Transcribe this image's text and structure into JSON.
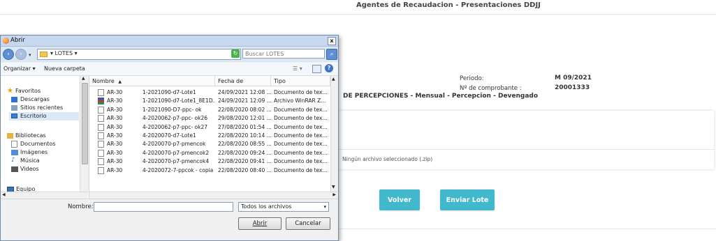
{
  "page": {
    "title": "Agentes de Recaudacion - Presentaciones DDJJ",
    "periodo_label": "Periodo:",
    "periodo_value": "M 09/2021",
    "comprobante_label": "Nº de comprobante :",
    "comprobante_value": "20001333",
    "subtitle": "DE PERCEPCIONES - Mensual - Percepcion - Devengado",
    "file_status": "Ningún archivo seleccionado (.zip)",
    "volver_label": "Volver",
    "enviar_label": "Enviar Lote",
    "accent_color": "#41b8cc"
  },
  "dialog": {
    "title": "Abrir",
    "close": "x",
    "address": "▾ LOTES ▾",
    "search_placeholder": "Buscar LOTES",
    "toolbar": {
      "organize": "Organizar ▾",
      "new_folder": "Nueva carpeta"
    },
    "nav": {
      "favorites": "Favoritos",
      "descargas": "Descargas",
      "recientes": "Sitios recientes",
      "escritorio": "Escritorio",
      "bibliotecas": "Bibliotecas",
      "documentos": "Documentos",
      "imagenes": "Imágenes",
      "musica": "Música",
      "videos": "Videos",
      "equipo": "Equipo"
    },
    "columns": {
      "name": "Nombre",
      "date": "Fecha de modifica...",
      "type": "Tipo"
    },
    "files": [
      {
        "prefix": "AR-30",
        "name": "1-2021090-d7-Lote1",
        "date": "24/09/2021 12:08 ...",
        "type": "Documento de tex...",
        "icon": "text-file-icon"
      },
      {
        "prefix": "AR-30",
        "name": "1-2021090-d7-Lote1_8E1D...",
        "date": "24/09/2021 12:09 ...",
        "type": "Archivo WinRAR Z...",
        "icon": "winrar-icon"
      },
      {
        "prefix": "AR-30",
        "name": "1-2021090-D7-ppc- ok",
        "date": "22/08/2020 08:02 ...",
        "type": "Documento de tex...",
        "icon": "text-file-icon"
      },
      {
        "prefix": "AR-30",
        "name": "4-2020062-p7-ppc- ok26",
        "date": "29/08/2020 12:01 ...",
        "type": "Documento de tex...",
        "icon": "text-file-icon"
      },
      {
        "prefix": "AR-30",
        "name": "4-2020062-p7-ppc- ok27",
        "date": "27/08/2020 01:54 ...",
        "type": "Documento de tex...",
        "icon": "text-file-icon"
      },
      {
        "prefix": "AR-30",
        "name": "4-2020070-d7-Lote1",
        "date": "22/08/2020 10:14 ...",
        "type": "Documento de tex...",
        "icon": "text-file-icon"
      },
      {
        "prefix": "AR-30",
        "name": "4-2020070-p7-pmencok",
        "date": "22/08/2020 08:55 ...",
        "type": "Documento de tex...",
        "icon": "text-file-icon"
      },
      {
        "prefix": "AR-30",
        "name": "4-2020070-p7-pmencok2",
        "date": "22/08/2020 09:24 ...",
        "type": "Documento de tex...",
        "icon": "text-file-icon"
      },
      {
        "prefix": "AR-30",
        "name": "4-2020070-p7-pmencok4",
        "date": "22/08/2020 09:41 ...",
        "type": "Documento de tex...",
        "icon": "text-file-icon"
      },
      {
        "prefix": "AR-30",
        "name": "4-2020072-7-ppcok - copia",
        "date": "22/08/2020 08:40 ...",
        "type": "Documento de tex...",
        "icon": "text-file-icon"
      }
    ],
    "filename_label": "Nombre:",
    "filename_value": "",
    "filter_value": "Todos los archivos",
    "open_label": "Abrir",
    "cancel_label": "Cancelar"
  }
}
